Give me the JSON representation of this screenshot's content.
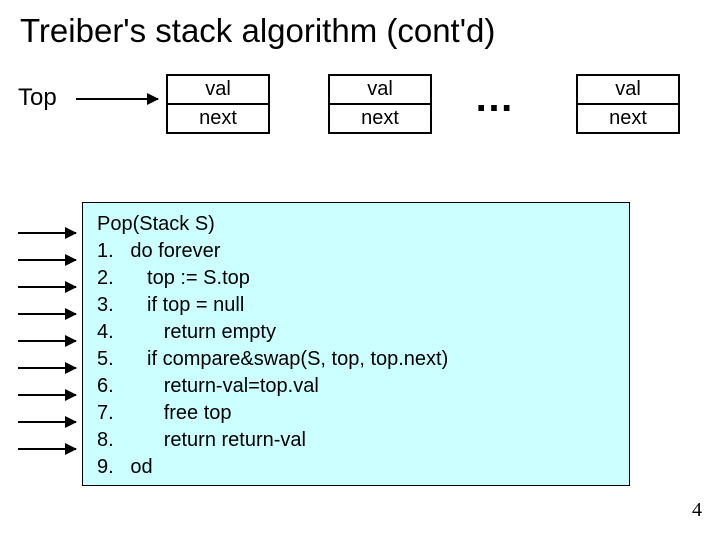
{
  "title": "Treiber's stack algorithm (cont'd)",
  "top_label": "Top",
  "node": {
    "val": "val",
    "next": "next"
  },
  "dots": "…",
  "code": {
    "l0": "Pop(Stack S)",
    "l1": "1.   do forever",
    "l2": "2.      top := S.top",
    "l3": "3.      if top = null",
    "l4": "4.         return empty",
    "l5": "5.      if compare&swap(S, top, top.next)",
    "l6": "6.         return-val=top.val",
    "l7": "7.         free top",
    "l8": "8.         return return-val",
    "l9": "9.   od"
  },
  "page_number": "4"
}
